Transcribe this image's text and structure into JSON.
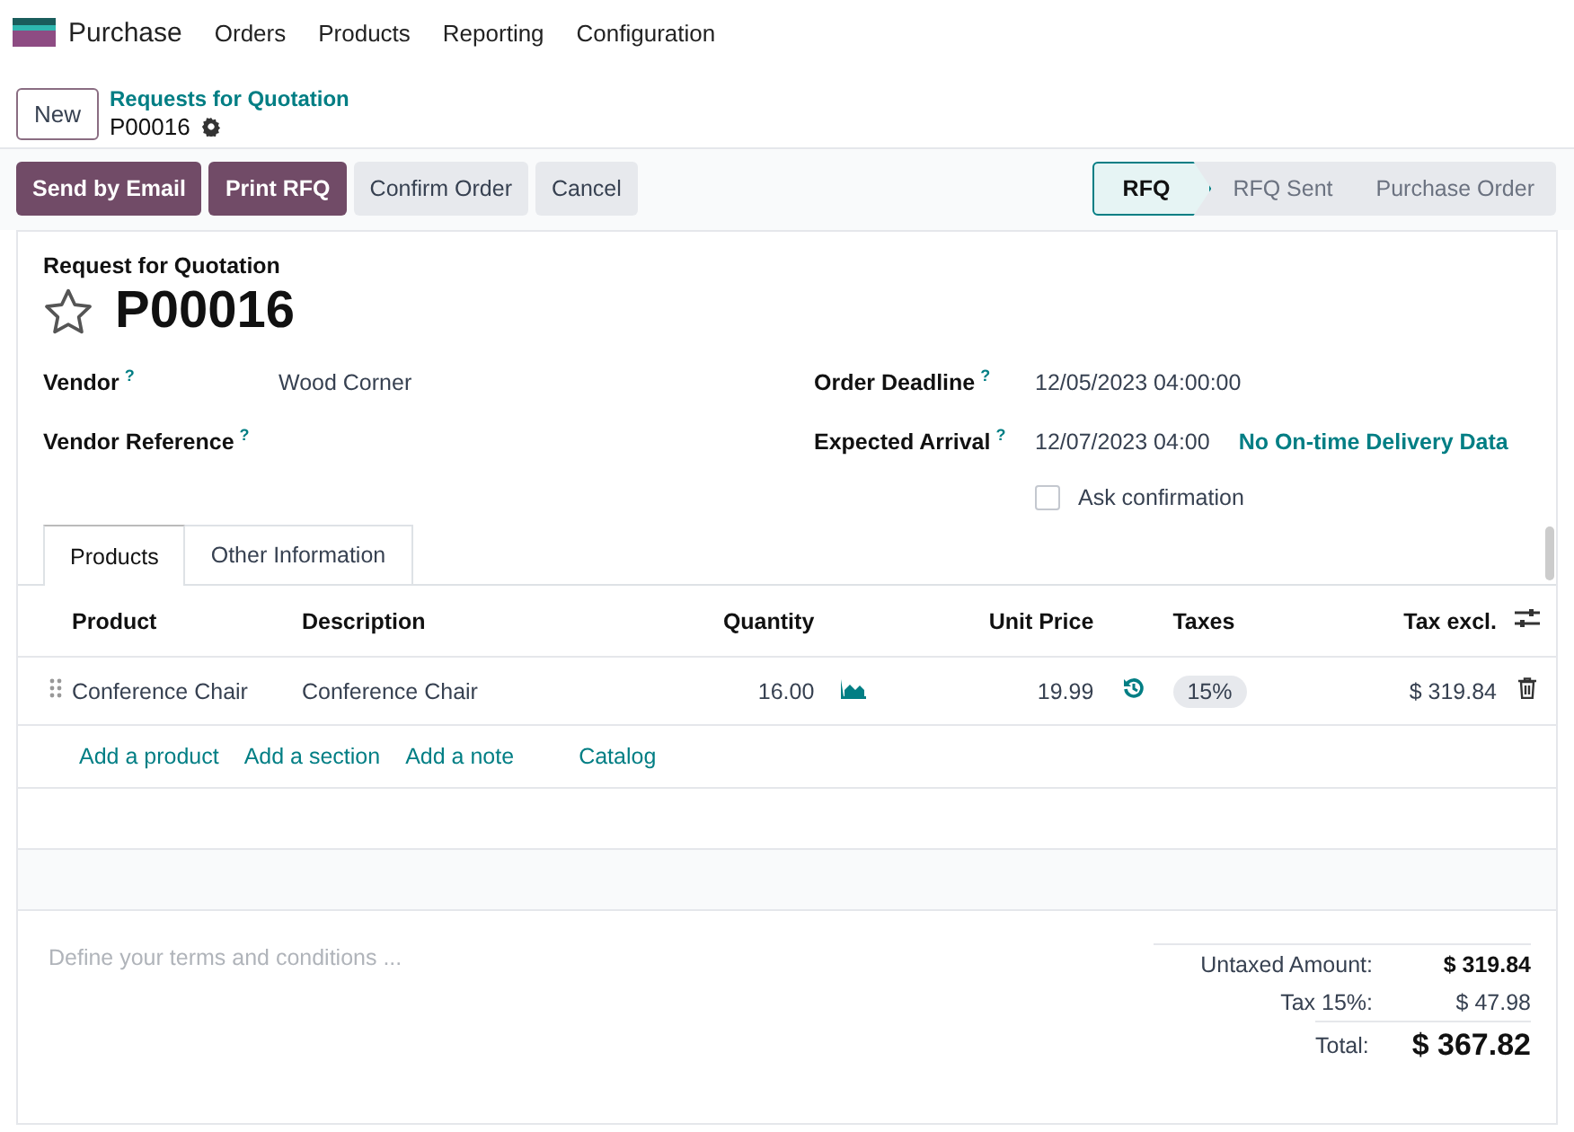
{
  "app": {
    "name": "Purchase",
    "menu": [
      "Orders",
      "Products",
      "Reporting",
      "Configuration"
    ]
  },
  "breadcrumb": {
    "new_button": "New",
    "parent": "Requests for Quotation",
    "current": "P00016"
  },
  "actions": [
    {
      "label": "Send by Email",
      "kind": "primary"
    },
    {
      "label": "Print RFQ",
      "kind": "primary"
    },
    {
      "label": "Confirm Order",
      "kind": "secondary"
    },
    {
      "label": "Cancel",
      "kind": "secondary"
    }
  ],
  "stages": [
    {
      "label": "RFQ",
      "selected": true
    },
    {
      "label": "RFQ Sent",
      "selected": false
    },
    {
      "label": "Purchase Order",
      "selected": false
    }
  ],
  "form": {
    "subtitle": "Request for Quotation",
    "title": "P00016",
    "starred": false,
    "left_fields": [
      {
        "label": "Vendor",
        "help": "?",
        "value": "Wood Corner"
      },
      {
        "label": "Vendor Reference",
        "help": "?"
      }
    ],
    "right_fields": [
      {
        "label": "Order Deadline",
        "help": "?",
        "value": "12/05/2023 04:00:00"
      },
      {
        "label": "Expected Arrival",
        "help": "?",
        "value": "12/07/2023 04:00",
        "link": "No On-time Delivery Data"
      }
    ],
    "ask_confirmation": {
      "label": "Ask confirmation",
      "checked": false
    }
  },
  "tabs": [
    {
      "label": "Products",
      "selected": true
    },
    {
      "label": "Other Information",
      "selected": false
    }
  ],
  "table": {
    "columns": [
      "Product",
      "Description",
      "Quantity",
      "Unit Price",
      "Taxes",
      "Tax excl."
    ],
    "rows": [
      {
        "product": "Conference Chair",
        "description": "Conference Chair",
        "quantity": "16.00",
        "unit_price": "19.99",
        "tax": "15%",
        "subtotal": "$ 319.84"
      }
    ],
    "add_links": [
      "Add a product",
      "Add a section",
      "Add a note",
      "Catalog"
    ]
  },
  "terms": {
    "placeholder": "Define your terms and conditions ..."
  },
  "totals": [
    {
      "label": "Untaxed Amount:",
      "value": "$ 319.84",
      "kind": "bold"
    },
    {
      "label": "Tax 15%:",
      "value": "$ 47.98",
      "kind": "normal"
    },
    {
      "label": "Total:",
      "value": "$ 367.82",
      "kind": "grand"
    }
  ]
}
